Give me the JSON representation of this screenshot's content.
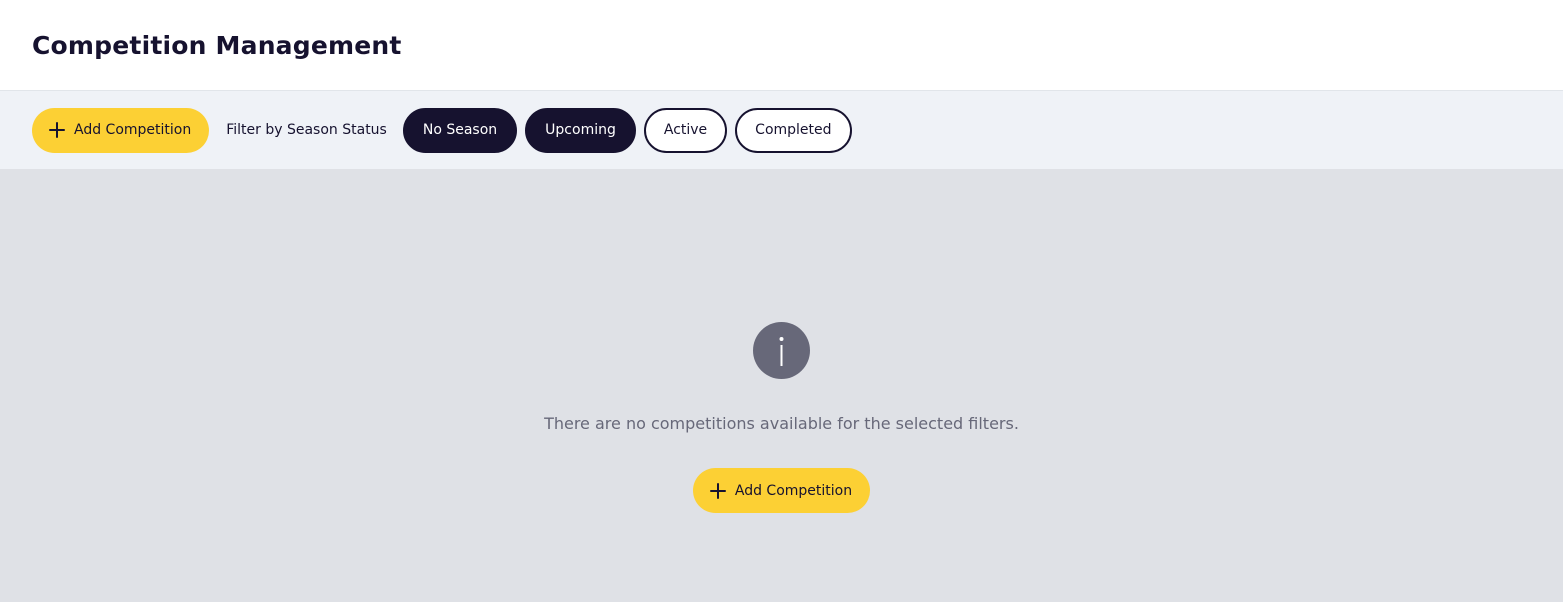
{
  "header": {
    "title": "Competition Management"
  },
  "toolbar": {
    "add_label": "Add Competition",
    "filter_label": "Filter by Season Status",
    "filters": [
      {
        "label": "No Season",
        "selected": true
      },
      {
        "label": "Upcoming",
        "selected": true
      },
      {
        "label": "Active",
        "selected": false
      },
      {
        "label": "Completed",
        "selected": false
      }
    ]
  },
  "empty_state": {
    "icon": "info-icon",
    "message": "There are no competitions available for the selected filters.",
    "add_label": "Add Competition"
  },
  "colors": {
    "accent": "#fcd034",
    "dark": "#16122f",
    "toolbar_bg": "#eff2f7",
    "content_bg": "#dfe1e6",
    "muted": "#676879"
  }
}
